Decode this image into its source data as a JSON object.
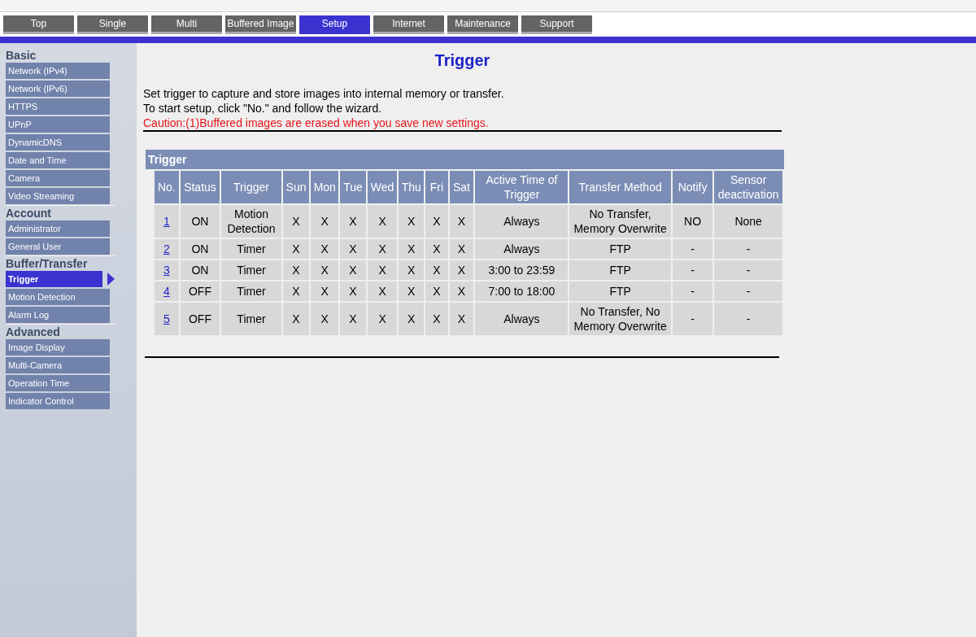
{
  "tabs": [
    {
      "label": "Top",
      "selected": false
    },
    {
      "label": "Single",
      "selected": false
    },
    {
      "label": "Multi",
      "selected": false
    },
    {
      "label": "Buffered Image",
      "selected": false
    },
    {
      "label": "Setup",
      "selected": true
    },
    {
      "label": "Internet",
      "selected": false
    },
    {
      "label": "Maintenance",
      "selected": false
    },
    {
      "label": "Support",
      "selected": false
    }
  ],
  "sidebar": {
    "sections": [
      {
        "heading": "Basic",
        "items": [
          {
            "label": "Network (IPv4)",
            "selected": false
          },
          {
            "label": "Network (IPv6)",
            "selected": false
          },
          {
            "label": "HTTPS",
            "selected": false
          },
          {
            "label": "UPnP",
            "selected": false
          },
          {
            "label": "DynamicDNS",
            "selected": false
          },
          {
            "label": "Date and Time",
            "selected": false
          },
          {
            "label": "Camera",
            "selected": false
          },
          {
            "label": "Video Streaming",
            "selected": false
          }
        ]
      },
      {
        "heading": "Account",
        "items": [
          {
            "label": "Administrator",
            "selected": false
          },
          {
            "label": "General User",
            "selected": false
          }
        ]
      },
      {
        "heading": "Buffer/Transfer",
        "items": [
          {
            "label": "Trigger",
            "selected": true
          },
          {
            "label": "Motion Detection",
            "selected": false
          },
          {
            "label": "Alarm Log",
            "selected": false
          }
        ]
      },
      {
        "heading": "Advanced",
        "items": [
          {
            "label": "Image Display",
            "selected": false
          },
          {
            "label": "Multi-Camera",
            "selected": false
          },
          {
            "label": "Operation Time",
            "selected": false
          },
          {
            "label": "Indicator Control",
            "selected": false
          }
        ]
      }
    ]
  },
  "page": {
    "title": "Trigger",
    "intro": [
      "Set trigger to capture and store images into internal memory or transfer.",
      "To start setup, click \"No.\" and follow the wizard."
    ],
    "caution": "Caution:(1)Buffered images are erased when you save new settings."
  },
  "table": {
    "title": "Trigger",
    "columns": [
      "No.",
      "Status",
      "Trigger",
      "Sun",
      "Mon",
      "Tue",
      "Wed",
      "Thu",
      "Fri",
      "Sat",
      "Active Time of Trigger",
      "Transfer Method",
      "Notify",
      "Sensor deactivation"
    ],
    "rows": [
      {
        "cells": [
          "1",
          "ON",
          "Motion Detection",
          "X",
          "X",
          "X",
          "X",
          "X",
          "X",
          "X",
          "Always",
          "No Transfer, Memory Overwrite",
          "NO",
          "None"
        ]
      },
      {
        "cells": [
          "2",
          "ON",
          "Timer",
          "X",
          "X",
          "X",
          "X",
          "X",
          "X",
          "X",
          "Always",
          "FTP",
          "-",
          "-"
        ]
      },
      {
        "cells": [
          "3",
          "ON",
          "Timer",
          "X",
          "X",
          "X",
          "X",
          "X",
          "X",
          "X",
          "3:00 to 23:59",
          "FTP",
          "-",
          "-"
        ]
      },
      {
        "cells": [
          "4",
          "OFF",
          "Timer",
          "X",
          "X",
          "X",
          "X",
          "X",
          "X",
          "X",
          "7:00 to 18:00",
          "FTP",
          "-",
          "-"
        ]
      },
      {
        "cells": [
          "5",
          "OFF",
          "Timer",
          "X",
          "X",
          "X",
          "X",
          "X",
          "X",
          "X",
          "Always",
          "No Transfer, No Memory Overwrite",
          "-",
          "-"
        ]
      }
    ]
  }
}
